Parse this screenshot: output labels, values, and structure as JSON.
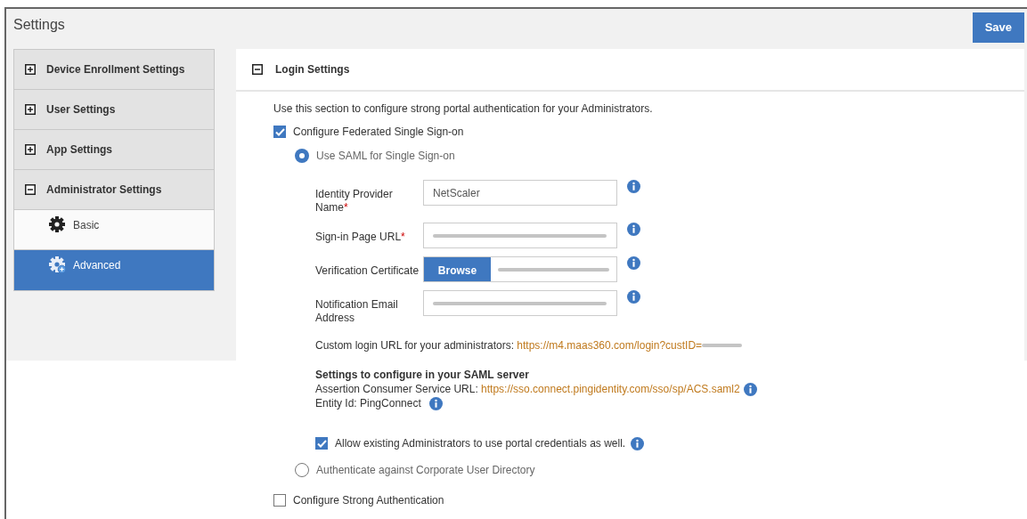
{
  "header": {
    "title": "Settings",
    "save_button": "Save"
  },
  "sidebar": {
    "items": [
      {
        "label": "Device Enrollment Settings",
        "expanded": false
      },
      {
        "label": "User Settings",
        "expanded": false
      },
      {
        "label": "App Settings",
        "expanded": false
      },
      {
        "label": "Administrator Settings",
        "expanded": true,
        "children": [
          {
            "label": "Basic",
            "kind": "gear",
            "selected": false
          },
          {
            "label": "Advanced",
            "kind": "gear-plus",
            "selected": true
          }
        ]
      }
    ]
  },
  "section": {
    "title": "Login Settings",
    "expanded": true,
    "description": "Use this section to configure strong portal authentication for your Administrators.",
    "federated": {
      "label": "Configure Federated Single Sign-on",
      "checked": true
    },
    "methods": [
      {
        "label": "Use SAML for Single Sign-on",
        "selected": true,
        "fields": [
          {
            "kind": "text",
            "label": "Identity Provider Name",
            "required_mark": "*",
            "value": "NetScaler"
          },
          {
            "kind": "text",
            "label": "Sign-in Page URL",
            "required_mark": "*",
            "value_blurred": true
          },
          {
            "kind": "file",
            "label": "Verification Certificate",
            "button": "Browse",
            "value_blurred": true
          },
          {
            "kind": "text",
            "label": "Notification Email Address",
            "value_blurred": true
          }
        ],
        "custom_login": {
          "label": "Custom login URL for your administrators:",
          "url": "https://m4.maas360.com/login?custID=",
          "url_blurred": true
        },
        "saml_server": {
          "heading": "Settings to configure in your SAML server",
          "acs_label": "Assertion Consumer Service URL:",
          "acs_url": "https://sso.connect.pingidentity.com/sso/sp/ACS.saml2",
          "entity": "Entity Id: PingConnect"
        },
        "allow_portal": {
          "label": "Allow existing Administrators to use portal credentials as well.",
          "checked": true
        }
      },
      {
        "label": "Authenticate against Corporate User Directory",
        "selected": false
      }
    ],
    "strong_auth": {
      "label": "Configure Strong Authentication",
      "checked": false
    }
  }
}
